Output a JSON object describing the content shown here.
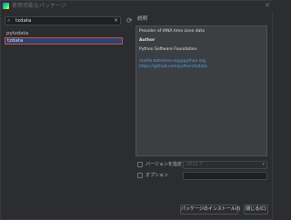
{
  "window": {
    "title": "使用可能なパッケージ"
  },
  "search": {
    "value": "tzdata",
    "placeholder": ""
  },
  "packages": [
    {
      "name": "pytzdata",
      "selected": false
    },
    {
      "name": "tzdata",
      "selected": true
    }
  ],
  "description": {
    "label": "説明",
    "summary": "Provider of IANA time zone data",
    "author_label": "Author",
    "author": "Python Software Foundation",
    "email": "mailto:datetime-sig@python.org",
    "url": "https://github.com/python/tzdata"
  },
  "options": {
    "version_label": "バージョンを指定する",
    "version_value": "2022.7",
    "options_label": "オプション"
  },
  "buttons": {
    "install": "パッケージのインストール(I)",
    "close": "閉じる(C)"
  },
  "icons": {
    "app": "pycharm-icon",
    "search": "search-icon",
    "clear": "clear-icon",
    "refresh": "refresh-icon",
    "close": "close-icon",
    "dropdown": "chevron-down-icon"
  },
  "colors": {
    "background": "#2b2d30",
    "selection": "#2e436e",
    "highlight_border": "#c94f4f",
    "link": "#589df6"
  }
}
